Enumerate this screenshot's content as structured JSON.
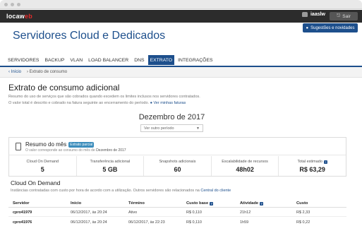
{
  "topbar": {
    "logo_main": "locaw",
    "logo_accent": "eb",
    "user": "iaaslw",
    "logout_label": "Sair"
  },
  "header": {
    "title": "Servidores Cloud e Dedicados",
    "suggestions_label": "Sugestões e novidades"
  },
  "tabs": [
    {
      "label": "SERVIDORES",
      "active": false
    },
    {
      "label": "BACKUP",
      "active": false
    },
    {
      "label": "VLAN",
      "active": false
    },
    {
      "label": "LOAD BALANCER",
      "active": false
    },
    {
      "label": "DNS",
      "active": false
    },
    {
      "label": "EXTRATO",
      "active": true
    },
    {
      "label": "INTEGRAÇÕES",
      "active": false
    }
  ],
  "breadcrumb": {
    "home": "‹ Início",
    "current": "› Extrato de consumo"
  },
  "page": {
    "title": "Extrato de consumo adicional",
    "desc1": "Resumo do uso de serviços que são cobrados quando excedem os limites inclusos nos servidores contratados.",
    "desc2": "O valor total é descrito e cobrado na fatura seguinte ao encerramento do período.",
    "desc2_link": "Ver minhas faturas",
    "month": "Dezembro de 2017",
    "period_select": "Ver outro período"
  },
  "summary": {
    "title": "Resumo do mês",
    "badge": "Extrato parcial",
    "subtitle": "O valor corresponde ao consumo do mês de",
    "subtitle_month": "Dezembro de 2017",
    "stats": [
      {
        "label": "Cloud On Demand",
        "value": "5",
        "help": false
      },
      {
        "label": "Transferência adicional",
        "value": "5 GB",
        "help": false
      },
      {
        "label": "Snapshots adicionais",
        "value": "60",
        "help": false
      },
      {
        "label": "Escalabilidade de recursos",
        "value": "48h02",
        "help": false
      },
      {
        "label": "Total estimado",
        "value": "R$ 63,29",
        "help": true
      }
    ]
  },
  "ondemand": {
    "title": "Cloud On Demand",
    "desc": "Instâncias contratadas com custo por hora de acordo com a utilização. Outros servidores são relacionados na",
    "desc_link": "Central do cliente",
    "columns": [
      "Servidor",
      "Início",
      "Término",
      "Custo base",
      "Atividade",
      "Custo"
    ],
    "rows": [
      [
        "cpro41979",
        "06/12/2017, às 20:24",
        "Ativo",
        "R$ 0,110",
        "21h12",
        "R$ 2,33"
      ],
      [
        "cpro41976",
        "06/12/2017, às 20:24",
        "06/12/2017, às 22:23",
        "R$ 0,110",
        "1h59",
        "R$ 0,22"
      ]
    ]
  }
}
